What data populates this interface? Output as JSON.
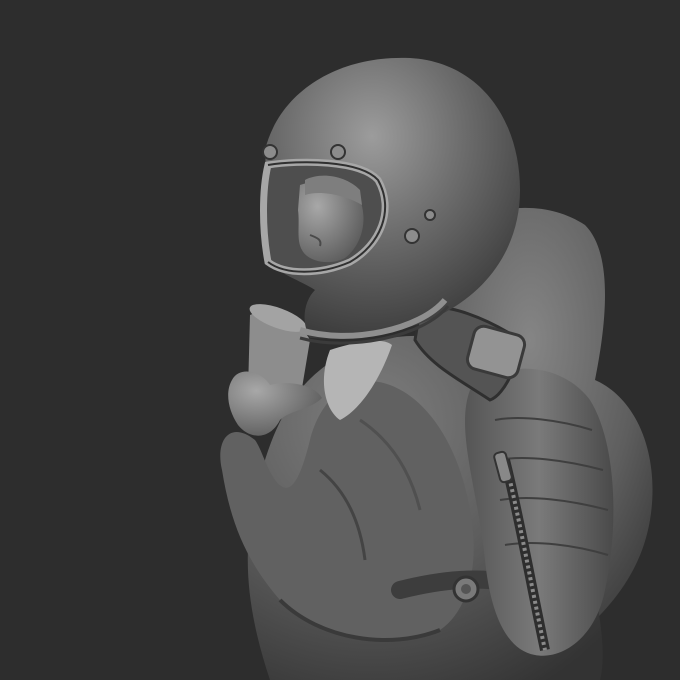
{
  "scene": {
    "background_color": "#2d2d2d",
    "clay_color": "#6e6e6e",
    "clay_highlight": "#9a9a9a",
    "clay_shadow": "#2f2f2f"
  }
}
